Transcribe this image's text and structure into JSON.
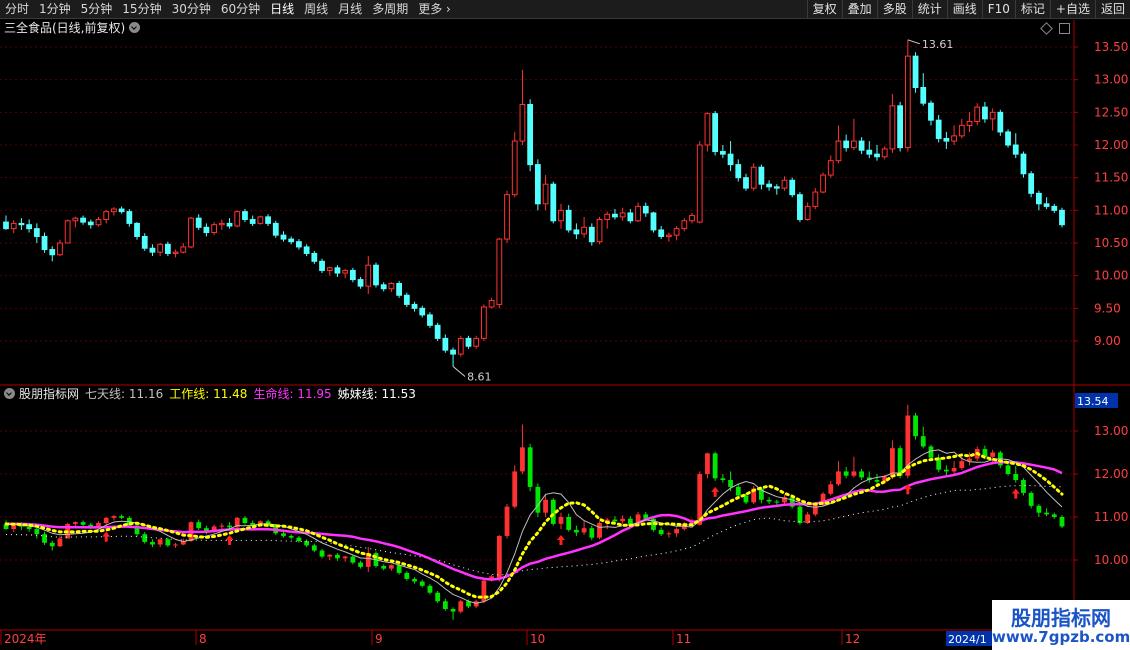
{
  "toolbar": {
    "periods": [
      "分时",
      "1分钟",
      "5分钟",
      "15分钟",
      "30分钟",
      "60分钟",
      "日线",
      "周线",
      "月线",
      "多周期",
      "更多"
    ],
    "active_period": "日线",
    "right_buttons": [
      "复权",
      "叠加",
      "多股",
      "统计",
      "画线",
      "F10",
      "标记",
      "+自选",
      "返回"
    ]
  },
  "main_chart": {
    "title": "三全食品(日线,前复权)",
    "price_axis": [
      "13.50",
      "13.00",
      "12.50",
      "12.00",
      "11.50",
      "11.00",
      "10.50",
      "10.00",
      "9.50",
      "9.00"
    ],
    "high_label": "13.61",
    "low_label": "8.61"
  },
  "indicator": {
    "name": "股朋指标网",
    "lines": [
      {
        "label": "七天线:",
        "value": "11.16",
        "color": "#c0c0c0"
      },
      {
        "label": "工作线:",
        "value": "11.48",
        "color": "#ffff00"
      },
      {
        "label": "生命线:",
        "value": "11.95",
        "color": "#ff33ff"
      },
      {
        "label": "姊妹线:",
        "value": "11.53",
        "color": "#ffffff"
      }
    ],
    "price_axis": [
      "13.00",
      "12.00",
      "11.00",
      "10.00"
    ],
    "current_tag": "13.54"
  },
  "time_axis": {
    "labels": [
      "2024年",
      "8",
      "9",
      "10",
      "11",
      "12"
    ],
    "current_tag": "2024/1"
  },
  "watermark": {
    "title": "股朋指标网",
    "url": "www.7gpzb.com"
  },
  "colors": {
    "up": "#ff3232",
    "down": "#54ffff",
    "ind_up": "#ff3232",
    "ind_down": "#00e600",
    "work_line": "#ffff00",
    "life_line": "#ff33ff",
    "axis": "#b00000"
  },
  "chart_data": {
    "type": "candlestick",
    "ylim": [
      8.5,
      13.7
    ],
    "note_series": "daily OHLC approximate",
    "ohlc": [
      [
        10.82,
        10.92,
        10.7,
        10.72
      ],
      [
        10.72,
        10.85,
        10.65,
        10.8
      ],
      [
        10.8,
        10.88,
        10.7,
        10.78
      ],
      [
        10.78,
        10.86,
        10.66,
        10.72
      ],
      [
        10.72,
        10.8,
        10.5,
        10.6
      ],
      [
        10.6,
        10.66,
        10.35,
        10.4
      ],
      [
        10.4,
        10.45,
        10.22,
        10.32
      ],
      [
        10.32,
        10.55,
        10.3,
        10.5
      ],
      [
        10.5,
        10.86,
        10.5,
        10.84
      ],
      [
        10.84,
        10.9,
        10.74,
        10.88
      ],
      [
        10.88,
        10.92,
        10.78,
        10.82
      ],
      [
        10.82,
        10.86,
        10.72,
        10.78
      ],
      [
        10.78,
        10.9,
        10.75,
        10.86
      ],
      [
        10.86,
        11.0,
        10.8,
        10.98
      ],
      [
        10.98,
        11.05,
        10.92,
        11.02
      ],
      [
        11.02,
        11.06,
        10.95,
        10.98
      ],
      [
        10.98,
        11.02,
        10.75,
        10.8
      ],
      [
        10.8,
        10.82,
        10.55,
        10.6
      ],
      [
        10.6,
        10.65,
        10.38,
        10.42
      ],
      [
        10.42,
        10.48,
        10.3,
        10.36
      ],
      [
        10.36,
        10.5,
        10.3,
        10.48
      ],
      [
        10.48,
        10.52,
        10.3,
        10.34
      ],
      [
        10.34,
        10.4,
        10.28,
        10.36
      ],
      [
        10.36,
        10.5,
        10.34,
        10.44
      ],
      [
        10.44,
        10.9,
        10.42,
        10.88
      ],
      [
        10.88,
        10.94,
        10.7,
        10.74
      ],
      [
        10.74,
        10.8,
        10.6,
        10.66
      ],
      [
        10.66,
        10.82,
        10.62,
        10.78
      ],
      [
        10.78,
        10.86,
        10.7,
        10.8
      ],
      [
        10.8,
        10.88,
        10.72,
        10.76
      ],
      [
        10.76,
        11.0,
        10.74,
        10.98
      ],
      [
        10.98,
        11.02,
        10.82,
        10.86
      ],
      [
        10.86,
        10.92,
        10.76,
        10.8
      ],
      [
        10.8,
        10.92,
        10.78,
        10.9
      ],
      [
        10.9,
        10.94,
        10.76,
        10.8
      ],
      [
        10.8,
        10.84,
        10.58,
        10.62
      ],
      [
        10.62,
        10.68,
        10.52,
        10.56
      ],
      [
        10.56,
        10.6,
        10.48,
        10.52
      ],
      [
        10.52,
        10.56,
        10.4,
        10.44
      ],
      [
        10.44,
        10.48,
        10.3,
        10.34
      ],
      [
        10.34,
        10.38,
        10.18,
        10.22
      ],
      [
        10.22,
        10.26,
        10.04,
        10.08
      ],
      [
        10.08,
        10.14,
        10.0,
        10.12
      ],
      [
        10.12,
        10.16,
        9.98,
        10.04
      ],
      [
        10.04,
        10.1,
        9.96,
        10.08
      ],
      [
        10.08,
        10.12,
        9.9,
        9.94
      ],
      [
        9.94,
        9.98,
        9.8,
        9.84
      ],
      [
        9.84,
        10.3,
        9.72,
        10.16
      ],
      [
        10.16,
        10.2,
        9.82,
        9.86
      ],
      [
        9.86,
        9.9,
        9.76,
        9.8
      ],
      [
        9.8,
        9.9,
        9.75,
        9.88
      ],
      [
        9.88,
        9.92,
        9.66,
        9.7
      ],
      [
        9.7,
        9.74,
        9.52,
        9.56
      ],
      [
        9.56,
        9.6,
        9.45,
        9.5
      ],
      [
        9.5,
        9.54,
        9.36,
        9.4
      ],
      [
        9.4,
        9.44,
        9.2,
        9.24
      ],
      [
        9.24,
        9.28,
        9.0,
        9.04
      ],
      [
        9.04,
        9.1,
        8.82,
        8.86
      ],
      [
        8.86,
        8.9,
        8.61,
        8.8
      ],
      [
        8.8,
        9.08,
        8.76,
        9.04
      ],
      [
        9.04,
        9.08,
        8.88,
        8.92
      ],
      [
        8.92,
        9.08,
        8.88,
        9.04
      ],
      [
        9.04,
        9.56,
        9.0,
        9.52
      ],
      [
        9.52,
        9.66,
        9.5,
        9.62
      ],
      [
        9.56,
        10.58,
        9.5,
        10.56
      ],
      [
        10.56,
        11.3,
        10.5,
        11.24
      ],
      [
        11.24,
        12.2,
        11.2,
        12.06
      ],
      [
        12.06,
        13.15,
        12.0,
        12.62
      ],
      [
        12.62,
        12.7,
        11.6,
        11.7
      ],
      [
        11.7,
        11.78,
        11.0,
        11.1
      ],
      [
        11.1,
        11.54,
        11.0,
        11.4
      ],
      [
        11.4,
        11.44,
        10.8,
        10.84
      ],
      [
        10.84,
        11.1,
        10.72,
        11.0
      ],
      [
        11.0,
        11.08,
        10.66,
        10.7
      ],
      [
        10.7,
        10.8,
        10.56,
        10.64
      ],
      [
        10.64,
        10.9,
        10.58,
        10.74
      ],
      [
        10.74,
        10.8,
        10.46,
        10.52
      ],
      [
        10.52,
        10.9,
        10.48,
        10.86
      ],
      [
        10.86,
        10.98,
        10.72,
        10.94
      ],
      [
        10.94,
        11.02,
        10.86,
        10.9
      ],
      [
        10.9,
        11.04,
        10.84,
        10.96
      ],
      [
        10.96,
        11.02,
        10.8,
        10.84
      ],
      [
        10.84,
        11.12,
        10.82,
        11.06
      ],
      [
        11.06,
        11.12,
        10.9,
        10.96
      ],
      [
        10.96,
        10.98,
        10.66,
        10.7
      ],
      [
        10.7,
        10.76,
        10.56,
        10.6
      ],
      [
        10.6,
        10.66,
        10.52,
        10.62
      ],
      [
        10.62,
        10.76,
        10.54,
        10.72
      ],
      [
        10.72,
        10.88,
        10.68,
        10.84
      ],
      [
        10.84,
        10.96,
        10.8,
        10.92
      ],
      [
        10.82,
        12.06,
        10.8,
        12.0
      ],
      [
        12.0,
        12.5,
        11.9,
        12.48
      ],
      [
        12.48,
        12.52,
        11.84,
        11.9
      ],
      [
        11.9,
        12.0,
        11.8,
        11.86
      ],
      [
        11.86,
        12.06,
        11.6,
        11.7
      ],
      [
        11.7,
        11.78,
        11.44,
        11.5
      ],
      [
        11.5,
        11.56,
        11.3,
        11.34
      ],
      [
        11.34,
        11.72,
        11.3,
        11.66
      ],
      [
        11.66,
        11.7,
        11.32,
        11.4
      ],
      [
        11.4,
        11.46,
        11.3,
        11.36
      ],
      [
        11.36,
        11.4,
        11.24,
        11.34
      ],
      [
        11.34,
        11.52,
        11.3,
        11.46
      ],
      [
        11.46,
        11.5,
        11.2,
        11.24
      ],
      [
        11.24,
        11.28,
        10.82,
        10.86
      ],
      [
        10.86,
        11.12,
        10.84,
        11.06
      ],
      [
        11.06,
        11.34,
        11.02,
        11.28
      ],
      [
        11.28,
        11.58,
        11.26,
        11.54
      ],
      [
        11.54,
        11.84,
        11.5,
        11.76
      ],
      [
        11.76,
        12.3,
        11.72,
        12.06
      ],
      [
        12.06,
        12.16,
        11.9,
        11.96
      ],
      [
        11.96,
        12.4,
        11.92,
        12.06
      ],
      [
        12.06,
        12.12,
        11.86,
        11.92
      ],
      [
        11.92,
        12.06,
        11.8,
        11.86
      ],
      [
        11.86,
        12.0,
        11.76,
        11.82
      ],
      [
        11.82,
        11.98,
        11.78,
        11.94
      ],
      [
        11.94,
        12.78,
        11.88,
        12.6
      ],
      [
        12.6,
        12.66,
        11.9,
        11.96
      ],
      [
        11.96,
        13.61,
        11.9,
        13.36
      ],
      [
        13.36,
        13.42,
        12.8,
        12.88
      ],
      [
        12.88,
        13.1,
        12.6,
        12.64
      ],
      [
        12.64,
        12.68,
        12.3,
        12.38
      ],
      [
        12.38,
        12.46,
        12.04,
        12.1
      ],
      [
        12.1,
        12.2,
        11.94,
        12.06
      ],
      [
        12.06,
        12.3,
        12.0,
        12.14
      ],
      [
        12.14,
        12.4,
        12.1,
        12.3
      ],
      [
        12.3,
        12.5,
        12.2,
        12.36
      ],
      [
        12.36,
        12.64,
        12.3,
        12.58
      ],
      [
        12.58,
        12.66,
        12.34,
        12.4
      ],
      [
        12.4,
        12.56,
        12.22,
        12.5
      ],
      [
        12.5,
        12.54,
        12.14,
        12.2
      ],
      [
        12.2,
        12.24,
        11.96,
        12.0
      ],
      [
        12.0,
        12.18,
        11.8,
        11.86
      ],
      [
        11.86,
        11.9,
        11.5,
        11.56
      ],
      [
        11.56,
        11.6,
        11.2,
        11.26
      ],
      [
        11.26,
        11.3,
        11.0,
        11.1
      ],
      [
        11.1,
        11.2,
        11.02,
        11.06
      ],
      [
        11.06,
        11.1,
        10.96,
        11.0
      ],
      [
        11.0,
        11.04,
        10.74,
        10.78
      ]
    ],
    "indicator_series": [
      {
        "name": "七天线",
        "value": 11.16
      },
      {
        "name": "工作线",
        "value": 11.48
      },
      {
        "name": "生命线",
        "value": 11.95
      },
      {
        "name": "姊妹线",
        "value": 11.53
      }
    ]
  }
}
